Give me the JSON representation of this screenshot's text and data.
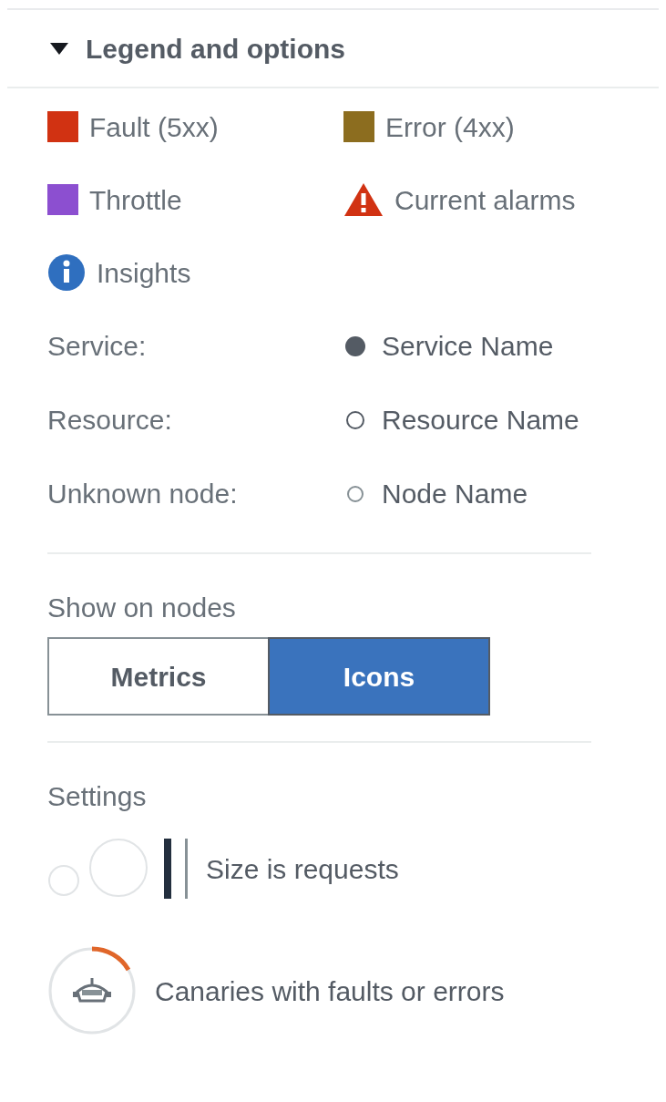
{
  "panel": {
    "title": "Legend and options",
    "expanded": true
  },
  "legend": [
    {
      "kind": "swatch",
      "label": "Fault (5xx)",
      "color": "#d13212"
    },
    {
      "kind": "swatch",
      "label": "Error (4xx)",
      "color": "#8c6d1f"
    },
    {
      "kind": "swatch",
      "label": "Throttle",
      "color": "#8c4fd0"
    },
    {
      "kind": "alarm",
      "label": "Current alarms"
    },
    {
      "kind": "insight",
      "label": "Insights"
    }
  ],
  "node_types": [
    {
      "label": "Service:",
      "kind": "filled",
      "name": "Service Name"
    },
    {
      "label": "Resource:",
      "kind": "outline",
      "name": "Resource Name"
    },
    {
      "label": "Unknown node:",
      "kind": "faint",
      "name": "Node Name"
    }
  ],
  "show_on_nodes": {
    "label": "Show on nodes",
    "options": [
      {
        "label": "Metrics",
        "selected": false
      },
      {
        "label": "Icons",
        "selected": true
      }
    ]
  },
  "settings": {
    "label": "Settings",
    "items": [
      {
        "kind": "size",
        "label": "Size is requests"
      },
      {
        "kind": "canary",
        "label": "Canaries with faults or errors"
      }
    ]
  }
}
